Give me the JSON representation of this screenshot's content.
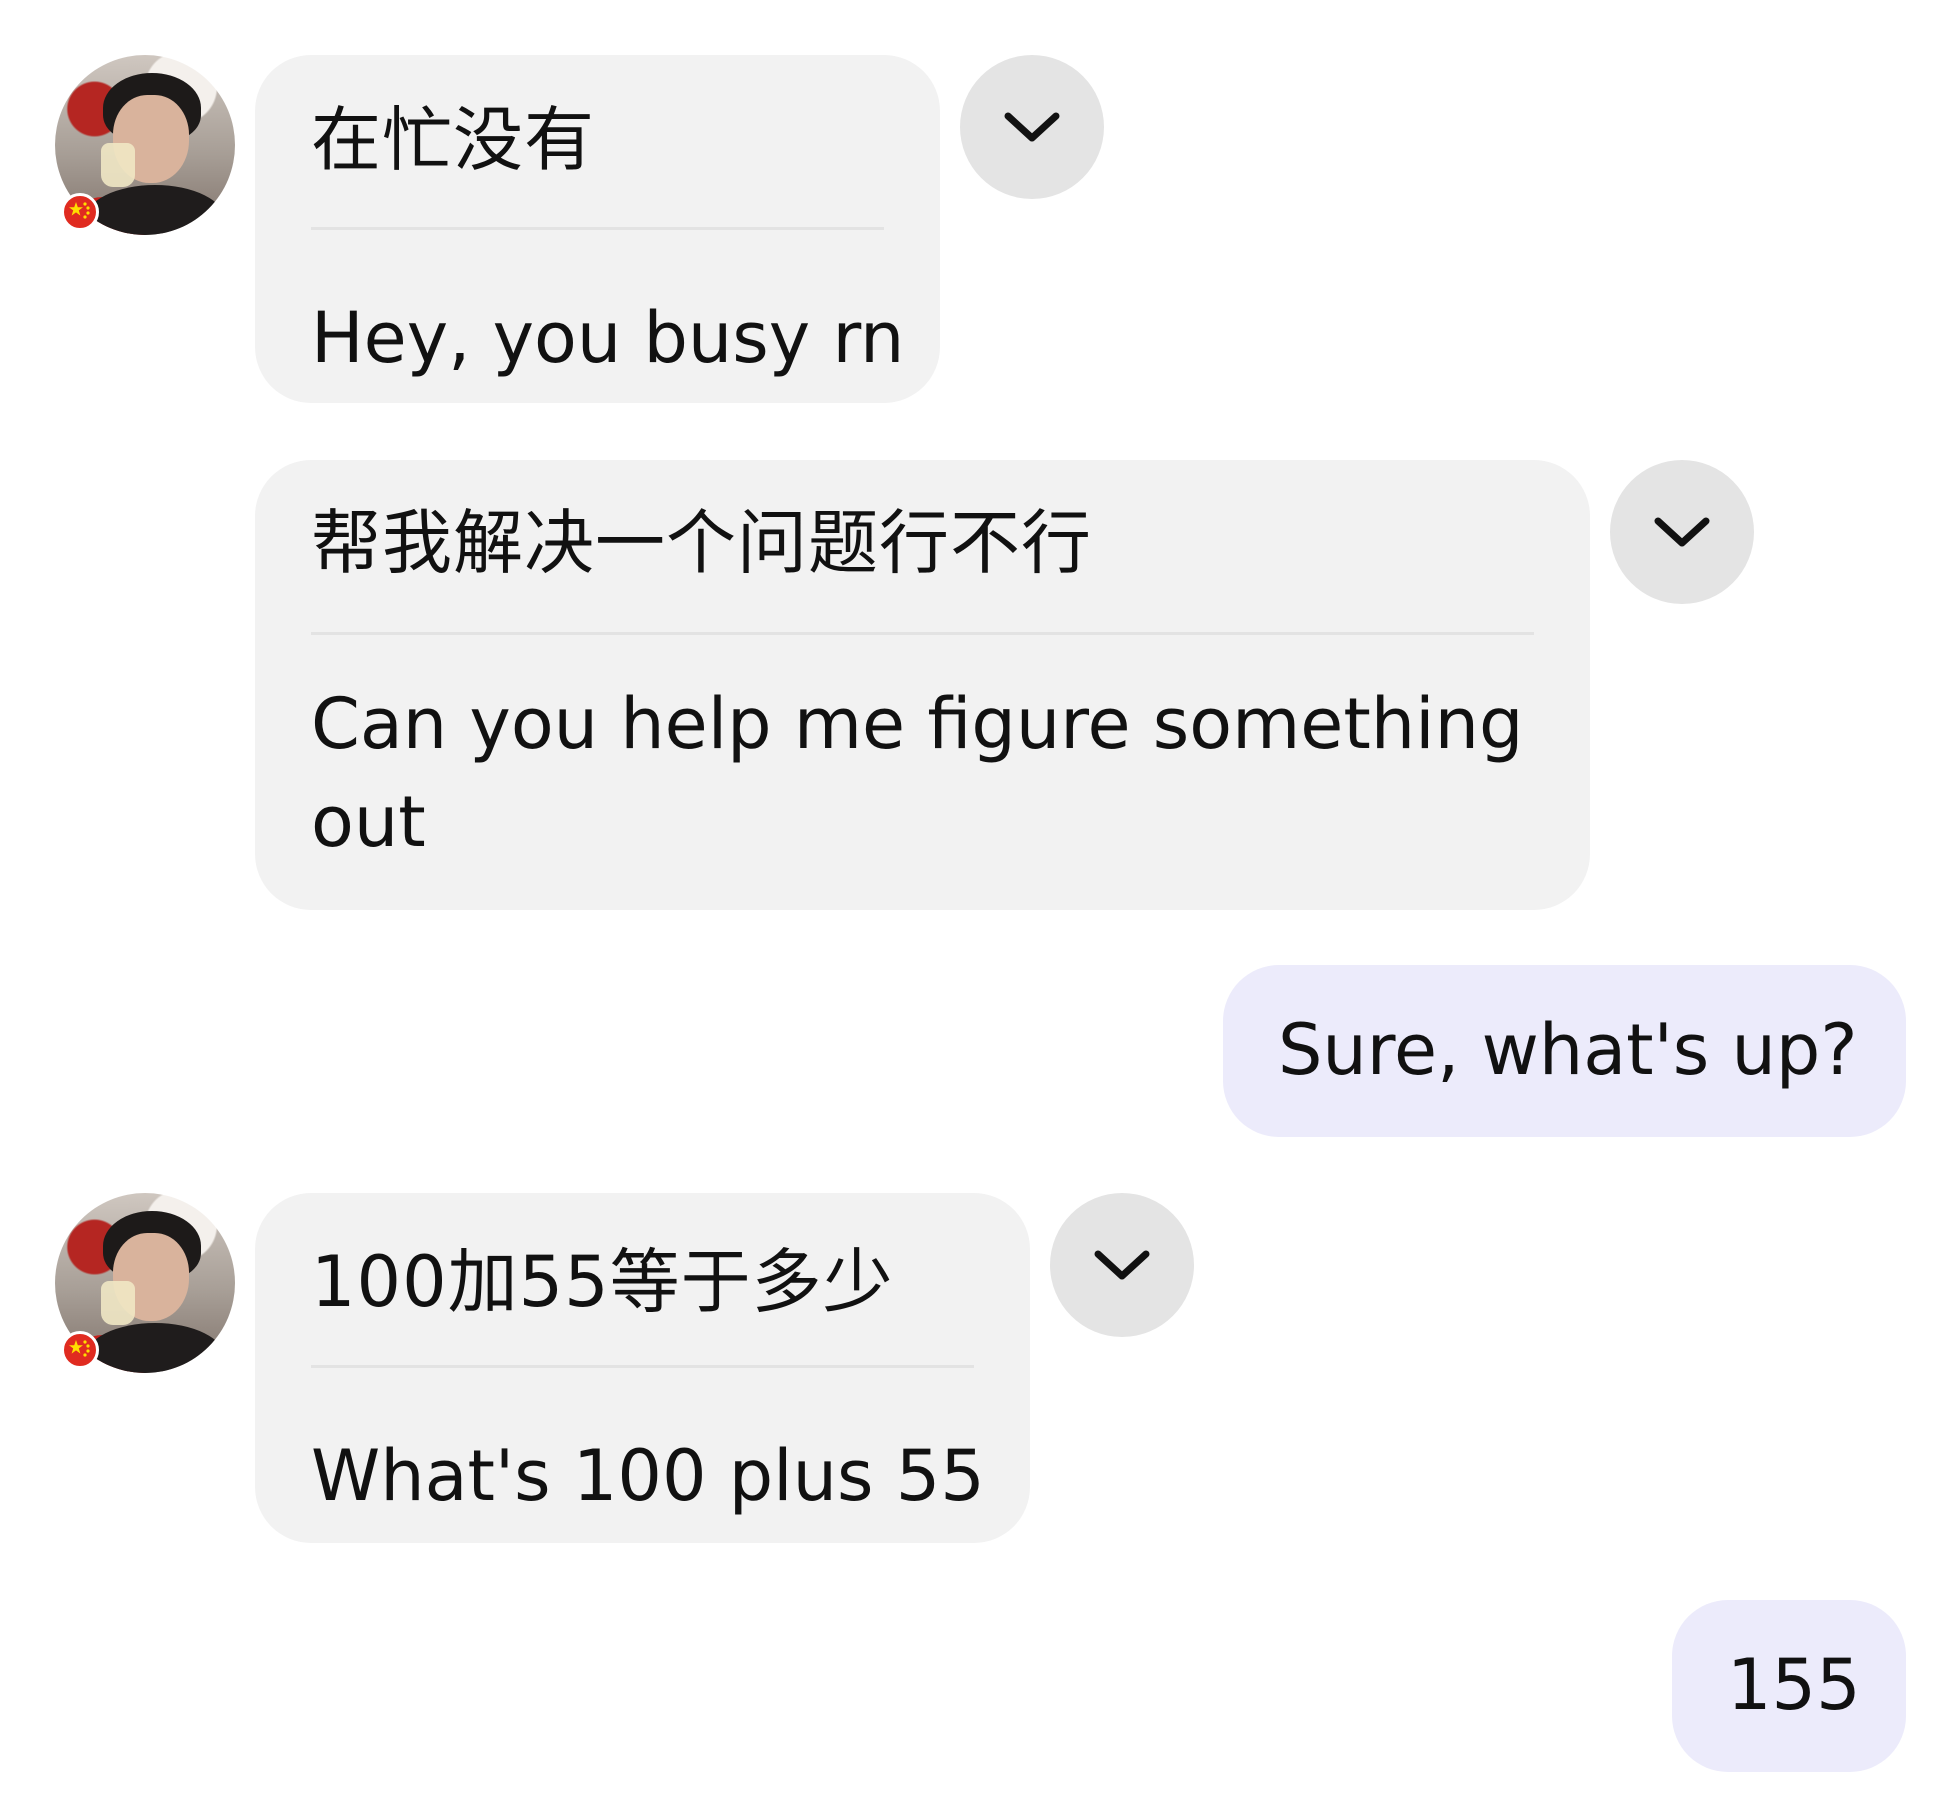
{
  "messages": [
    {
      "original": "在忙没有",
      "translation": "Hey, you busy rn"
    },
    {
      "original": "帮我解决一个问题行不行",
      "translation": "Can you help me figure something out"
    },
    {
      "reply": "Sure, what's up?"
    },
    {
      "original": "100加55等于多少",
      "translation": "What's 100 plus 55"
    },
    {
      "reply": "155"
    }
  ],
  "icons": {
    "expand": "chevron-down-icon",
    "flag": "china-flag-icon"
  },
  "colors": {
    "incoming_bubble": "#f2f2f2",
    "outgoing_bubble": "#ecebfb",
    "chevron_button": "#e4e4e4",
    "flag_red": "#e02b20",
    "flag_star": "#ffde00"
  }
}
